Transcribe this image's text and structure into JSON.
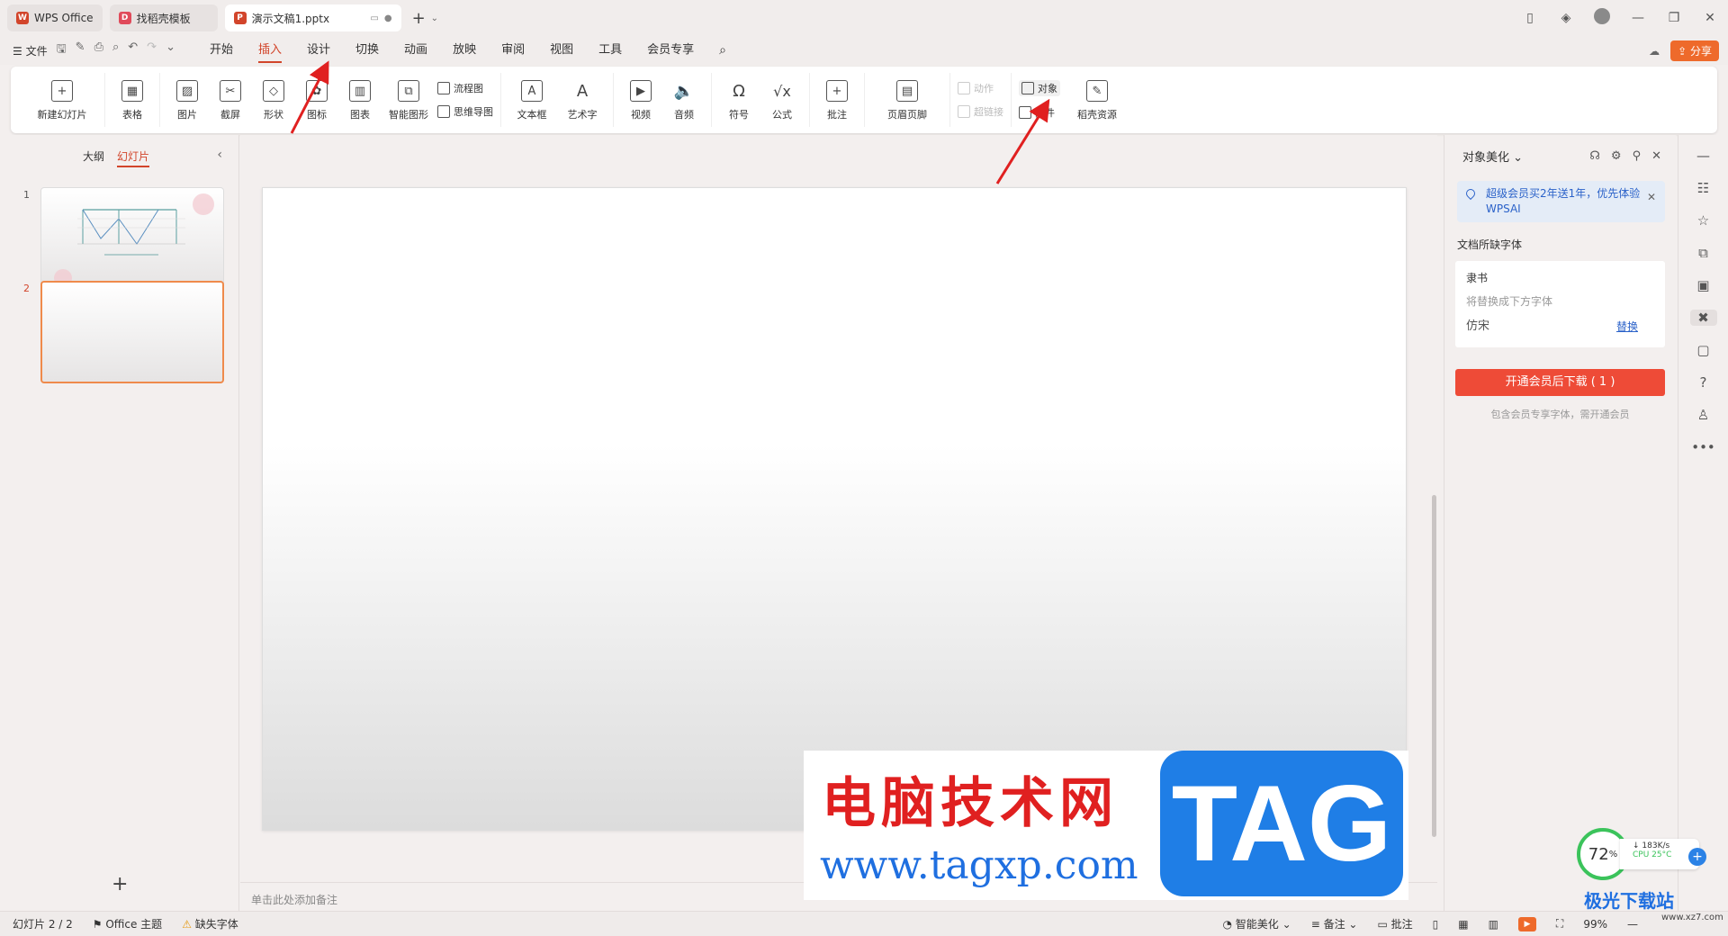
{
  "tabs": [
    {
      "label": "WPS Office",
      "color": "#d2452b"
    },
    {
      "label": "找稻壳模板",
      "color": "#d2452b"
    },
    {
      "label": "演示文稿1.pptx",
      "color": "#d2452b"
    }
  ],
  "menu": {
    "file": "文件",
    "tabs": [
      "开始",
      "插入",
      "设计",
      "切换",
      "动画",
      "放映",
      "审阅",
      "视图",
      "工具",
      "会员专享"
    ],
    "active_tab": "插入",
    "share": "分享"
  },
  "ribbon": {
    "new_slide": "新建幻灯片",
    "table": "表格",
    "picture": "图片",
    "screenshot": "截屏",
    "shape": "形状",
    "icon": "图标",
    "chart": "图表",
    "smart_graphic": "智能图形",
    "flowchart": "流程图",
    "mindmap": "思维导图",
    "textbox": "文本框",
    "wordart": "艺术字",
    "video": "视频",
    "audio": "音频",
    "symbol": "符号",
    "formula": "公式",
    "comment": "批注",
    "header_footer": "页眉页脚",
    "action": "动作",
    "hyperlink": "超链接",
    "object": "对象",
    "attachment": "附件",
    "docer_resources": "稻壳资源"
  },
  "left_panel": {
    "outline": "大纲",
    "slides": "幻灯片",
    "slide_numbers": [
      "1",
      "2"
    ]
  },
  "notes_placeholder": "单击此处添加备注",
  "right_panel": {
    "title": "对象美化",
    "promo": "超级会员买2年送1年，优先体验WPSAI",
    "missing_fonts_label": "文档所缺字体",
    "missing_font": "隶书",
    "replace_hint": "将替换成下方字体",
    "replacement_font": "仿宋",
    "replace_link": "替换",
    "download_button": "开通会员后下载 ( 1 )",
    "download_note": "包含会员专享字体，需开通会员"
  },
  "status": {
    "slide_count": "幻灯片 2 / 2",
    "theme": "Office 主题",
    "missing_font": "缺失字体",
    "smart_beautify": "智能美化",
    "notes": "备注",
    "comments": "批注",
    "zoom": "99%"
  },
  "watermark": {
    "cn_text": "电脑技术网",
    "url": "www.tagxp.com",
    "tag": "TAG",
    "corner_brand": "极光下载站",
    "corner_url": "www.xz7.com"
  },
  "perf": {
    "percent": "72",
    "percent_unit": "%",
    "net": "183K/s",
    "cpu": "CPU 25°C"
  },
  "colors": {
    "accent": "#d2452b",
    "share": "#ee6a2b",
    "download": "#ee4b37",
    "link": "#2b62c9"
  }
}
